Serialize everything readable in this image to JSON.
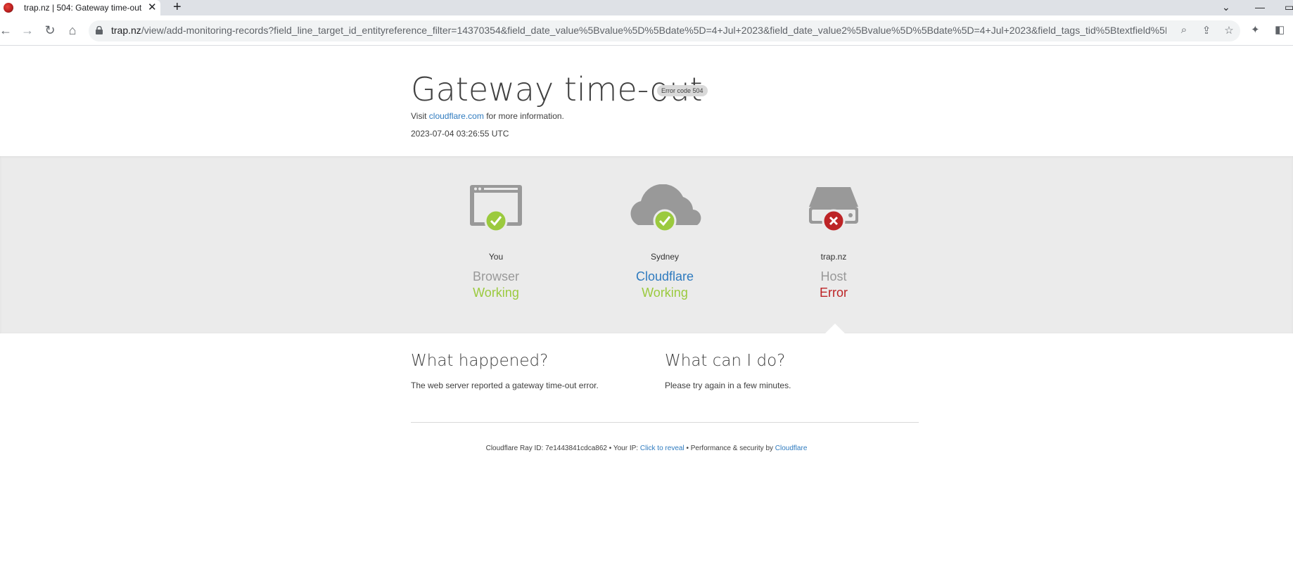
{
  "browser": {
    "tab_title": "trap.nz | 504: Gateway time-out",
    "tab_close": "✕",
    "new_tab": "+",
    "url_host": "trap.nz",
    "url_path": "/view/add-monitoring-records?field_line_target_id_entityreference_filter=14370354&field_date_value%5Bvalue%5D%5Bdate%5D=4+Jul+2023&field_date_value2%5Bvalue%5D%5Bdate%5D=4+Jul+2023&field_tags_tid%5Btextfield%5D..."
  },
  "page": {
    "title": "Gateway time-out",
    "error_badge": "Error code 504",
    "visit_prefix": "Visit",
    "visit_link": "cloudflare.com",
    "visit_suffix": "for more information.",
    "timestamp": "2023-07-04 03:26:55 UTC"
  },
  "status": [
    {
      "place": "You",
      "role": "Browser",
      "state": "Working",
      "ok": true
    },
    {
      "place": "Sydney",
      "role": "Cloudflare",
      "state": "Working",
      "ok": true
    },
    {
      "place": "trap.nz",
      "role": "Host",
      "state": "Error",
      "ok": false
    }
  ],
  "colors": {
    "ok": "#9bca3e",
    "error": "#bd2426",
    "link": "#2f7bbf",
    "icon_gray": "#999999"
  },
  "what_happened": {
    "heading": "What happened?",
    "text": "The web server reported a gateway time-out error."
  },
  "what_can_i_do": {
    "heading": "What can I do?",
    "text": "Please try again in a few minutes."
  },
  "footer": {
    "ray_label": "Cloudflare Ray ID:",
    "ray_id": "7e1443841cdca862",
    "sep1": "•",
    "ip_label": "Your IP:",
    "ip_link": "Click to reveal",
    "sep2": "•",
    "perf_label": "Performance & security by",
    "perf_link": "Cloudflare"
  }
}
